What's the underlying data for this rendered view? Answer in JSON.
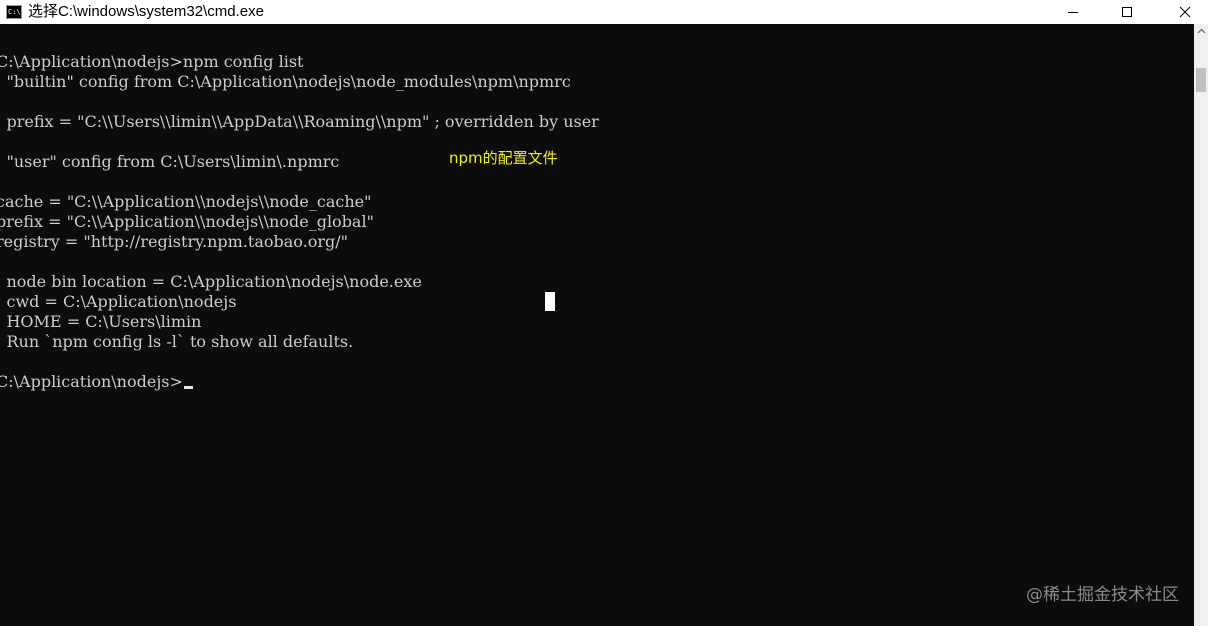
{
  "window": {
    "title": "选择C:\\windows\\system32\\cmd.exe",
    "icon_text": "C:\\",
    "icon": "console-app-icon",
    "controls": [
      "minimize-icon",
      "maximize-icon",
      "close-icon"
    ]
  },
  "console": {
    "lines": [
      "C:\\Application\\nodejs>npm config list",
      "; \"builtin\" config from C:\\Application\\nodejs\\node_modules\\npm\\npmrc",
      "",
      "; prefix = \"C:\\\\Users\\\\limin\\\\AppData\\\\Roaming\\\\npm\" ; overridden by user",
      "",
      "; \"user\" config from C:\\Users\\limin\\.npmrc",
      "",
      "cache = \"C:\\\\Application\\\\nodejs\\\\node_cache\"",
      "prefix = \"C:\\\\Application\\\\nodejs\\\\node_global\"",
      "registry = \"http://registry.npm.taobao.org/\"",
      "",
      "; node bin location = C:\\Application\\nodejs\\node.exe",
      "; cwd = C:\\Application\\nodejs",
      "; HOME = C:\\Users\\limin",
      "; Run `npm config ls -l` to show all defaults.",
      "",
      "C:\\Application\\nodejs>"
    ],
    "annotation": "npm的配置文件",
    "text_color": "#cccccc",
    "annotation_color": "#f0f000",
    "background": "#0c0c0c"
  },
  "watermark": "@稀土掘金技术社区"
}
